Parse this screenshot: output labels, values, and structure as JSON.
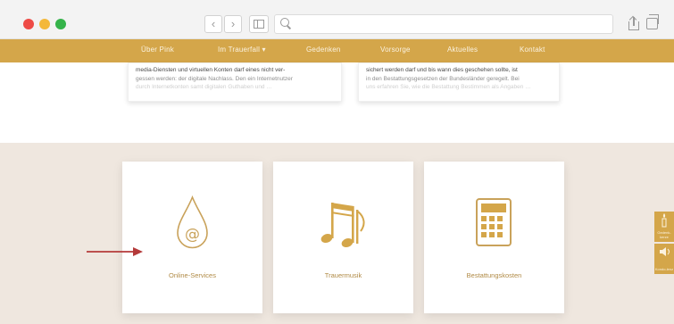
{
  "browser": {
    "back_symbol": "‹",
    "forward_symbol": "›",
    "icons": [
      "search-icon",
      "sidebar-icon",
      "share-icon",
      "tabs-icon"
    ]
  },
  "nav": {
    "items": [
      "Über Pink",
      "Im Trauerfall ▾",
      "Gedenken",
      "Vorsorge",
      "Aktuelles",
      "Kontakt"
    ],
    "background": "#d4a64a",
    "text_color": "#fbf2df"
  },
  "text_cards": [
    {
      "line1": "media-Diensten und virtuellen Konten darf eines nicht ver-",
      "line2": "gessen werden: der digitale Nachlass. Den ein Internetnutzer",
      "line3": "durch Internetkonten samt digitalen Guthaben und …"
    },
    {
      "line1": "sichert werden darf und bis wann dies geschehen sollte, ist",
      "line2": "in den Bestattungsgesetzen der Bundesländer geregelt. Bei",
      "line3": "uns erfahren Sie, wie die Bestattung Bestimmen als Angaben …"
    }
  ],
  "services": [
    {
      "label": "Online-Services",
      "icon": "at-drop-icon"
    },
    {
      "label": "Trauermusik",
      "icon": "music-notes-icon"
    },
    {
      "label": "Bestattungskosten",
      "icon": "calculator-icon"
    }
  ],
  "side_tabs": [
    {
      "label": "Gedenk-kerze",
      "icon": "candle-icon"
    },
    {
      "label": "Kondo-lenz",
      "icon": "speaker-icon"
    }
  ],
  "colors": {
    "accent_gold": "#d4a64a",
    "beige_bg": "#efe7df",
    "arrow_red": "#b43a3a"
  }
}
